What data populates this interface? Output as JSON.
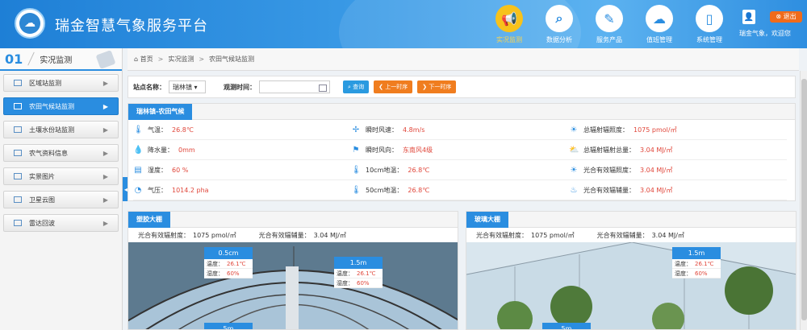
{
  "header": {
    "title": "瑞金智慧气象服务平台",
    "nav": [
      {
        "label": "实况监测",
        "icon": "megaphone-icon",
        "glyph": "📢",
        "active": true
      },
      {
        "label": "数据分析",
        "icon": "search-icon",
        "glyph": "⌕",
        "active": false
      },
      {
        "label": "服务产品",
        "icon": "document-edit-icon",
        "glyph": "✎",
        "active": false
      },
      {
        "label": "值班管理",
        "icon": "cloud-icon",
        "glyph": "☁",
        "active": false
      },
      {
        "label": "系统管理",
        "icon": "phone-icon",
        "glyph": "▯",
        "active": false
      }
    ],
    "logout": "退出",
    "welcome": "瑞金气象，欢迎您"
  },
  "sidebar": {
    "num": "01",
    "title": "实况监测",
    "items": [
      {
        "label": "区域站监测",
        "active": false
      },
      {
        "label": "农田气候站监测",
        "active": true
      },
      {
        "label": "土壤水份站监测",
        "active": false
      },
      {
        "label": "农气资料信息",
        "active": false
      },
      {
        "label": "实景图片",
        "active": false
      },
      {
        "label": "卫星云图",
        "active": false
      },
      {
        "label": "雷达回波",
        "active": false
      }
    ]
  },
  "breadcrumb": [
    "首页",
    "实况监测",
    "农田气候站监测"
  ],
  "filter": {
    "station_label": "站点名称：",
    "station_value": "瑞林镇",
    "time_label": "观测时间：",
    "query": "查询",
    "prev": "上一时序",
    "next": "下一时序"
  },
  "station": {
    "tab": "瑞林镇-农田气候",
    "cols": [
      [
        {
          "label": "气温：",
          "value": "26.8℃",
          "icon": "thermometer-icon",
          "glyph": "🌡"
        },
        {
          "label": "降水量：",
          "value": "0mm",
          "icon": "raindrop-icon",
          "glyph": "💧"
        },
        {
          "label": "湿度：",
          "value": "60 %",
          "icon": "humidity-icon",
          "glyph": "▤"
        },
        {
          "label": "气压：",
          "value": "1014.2 pha",
          "icon": "gauge-icon",
          "glyph": "◔"
        }
      ],
      [
        {
          "label": "瞬时风速：",
          "value": "4.8m/s",
          "icon": "wind-turbine-icon",
          "glyph": "✢"
        },
        {
          "label": "瞬时风向：",
          "value": "东南风4级",
          "icon": "wind-flag-icon",
          "glyph": "⚑"
        },
        {
          "label": "10cm地温：",
          "value": "26.8℃",
          "icon": "thermometer-icon",
          "glyph": "🌡"
        },
        {
          "label": "50cm地温：",
          "value": "26.8℃",
          "icon": "thermometer-icon",
          "glyph": "🌡"
        }
      ],
      [
        {
          "label": "总辐射辐照度：",
          "value": "1075 pmol/㎡",
          "icon": "sun-icon",
          "glyph": "☀"
        },
        {
          "label": "总辐射辐射总量：",
          "value": "3.04 MJ/㎡",
          "icon": "sun-cloud-icon",
          "glyph": "⛅"
        },
        {
          "label": "光合有效辐照度：",
          "value": "3.04 MJ/㎡",
          "icon": "sun-icon",
          "glyph": "☀"
        },
        {
          "label": "光合有效辐辅量：",
          "value": "3.04 MJ/㎡",
          "icon": "heat-icon",
          "glyph": "♨"
        }
      ]
    ]
  },
  "panels": [
    {
      "title": "塑胶大棚",
      "stat1_label": "光合有效辐射度：",
      "stat1_value": "1075 pmol/㎡",
      "stat2_label": "光合有效辐辅量：",
      "stat2_value": "3.04 MJ/㎡",
      "sensors": [
        {
          "title": "0.5cm",
          "temp_label": "温度：",
          "temp": "26.1℃",
          "hum_label": "湿度：",
          "hum": "60%"
        },
        {
          "title": "1.5m",
          "temp_label": "温度：",
          "temp": "26.1℃",
          "hum_label": "湿度：",
          "hum": "60%"
        },
        {
          "title": "5m"
        }
      ]
    },
    {
      "title": "玻璃大棚",
      "stat1_label": "光合有效辐射度：",
      "stat1_value": "1075 pmol/㎡",
      "stat2_label": "光合有效辐辅量：",
      "stat2_value": "3.04 MJ/㎡",
      "sensors": [
        {
          "title": "1.5m",
          "temp_label": "温度：",
          "temp": "26.1℃",
          "hum_label": "湿度：",
          "hum": "60%"
        },
        {
          "title": "5m"
        }
      ]
    }
  ]
}
